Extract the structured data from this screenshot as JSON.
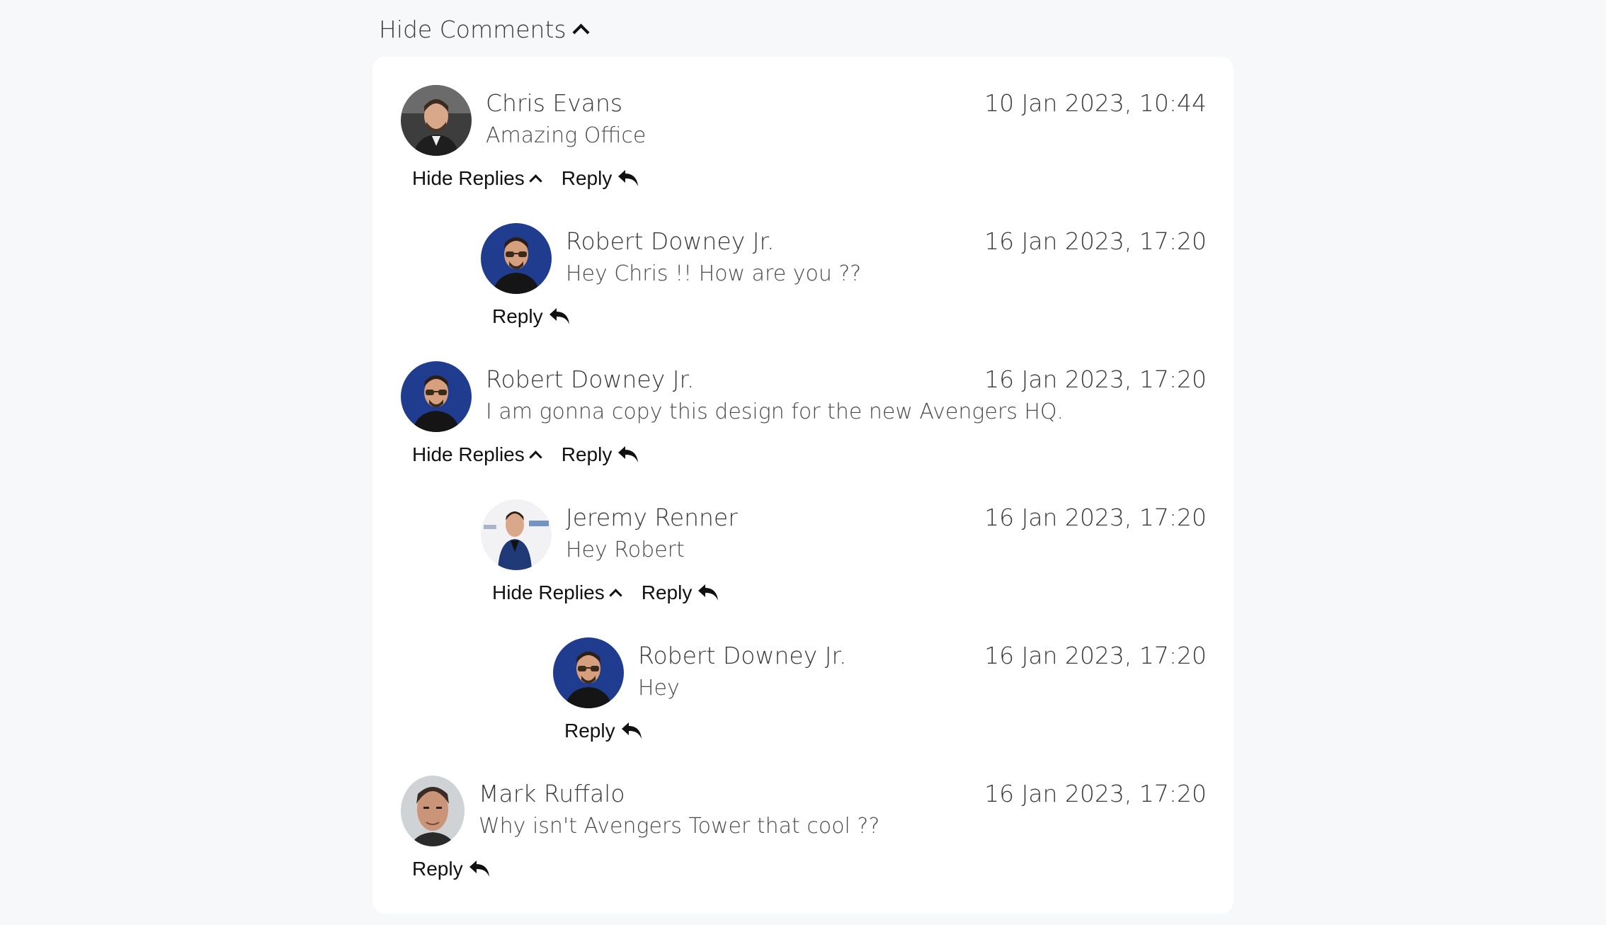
{
  "toggle_comments_label": "Hide Comments",
  "hide_replies_label": "Hide Replies",
  "reply_label": "Reply",
  "comments": [
    {
      "name": "Chris Evans",
      "text": "Amazing Office",
      "time": "10 Jan 2023, 10:44",
      "has_replies": true,
      "level": 0
    },
    {
      "name": "Robert Downey Jr.",
      "text": "Hey Chris !! How are you ??",
      "time": "16 Jan 2023, 17:20",
      "has_replies": false,
      "level": 1
    },
    {
      "name": "Robert Downey Jr.",
      "text": "I am gonna copy this design for the new Avengers HQ.",
      "time": "16 Jan 2023, 17:20",
      "has_replies": true,
      "level": 0
    },
    {
      "name": "Jeremy Renner",
      "text": "Hey Robert",
      "time": "16 Jan 2023, 17:20",
      "has_replies": true,
      "level": 1
    },
    {
      "name": "Robert Downey Jr.",
      "text": "Hey",
      "time": "16 Jan 2023, 17:20",
      "has_replies": false,
      "level": 2
    },
    {
      "name": "Mark Ruffalo",
      "text": "Why isn't Avengers Tower that cool ??",
      "time": "16 Jan 2023, 17:20",
      "has_replies": false,
      "level": 0
    }
  ],
  "colors": {
    "page_bg": "#f7f8fa",
    "card_bg": "#ffffff",
    "avatar_blue": "#1f3c8f",
    "text": "#3a3a3a"
  }
}
